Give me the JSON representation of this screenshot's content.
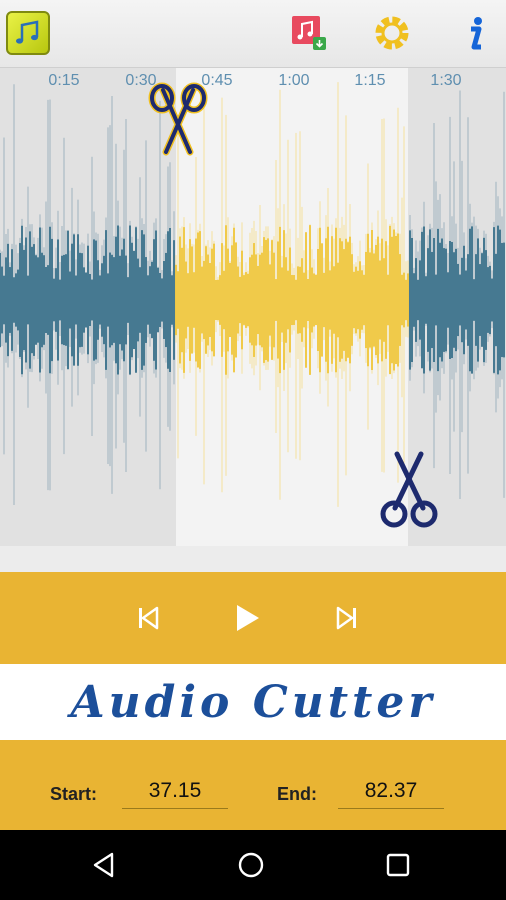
{
  "toolbar": {
    "app_icon": "music-notes-icon",
    "buttons": [
      "music-download-icon",
      "gear-icon",
      "info-icon"
    ]
  },
  "timeline": {
    "labels": [
      "0:15",
      "0:30",
      "0:45",
      "1:00",
      "1:15",
      "1:30"
    ]
  },
  "selection": {
    "start_handle_icon": "scissors-icon",
    "end_handle_icon": "scissors-icon"
  },
  "player": {
    "controls": [
      "skip-previous-icon",
      "play-icon",
      "skip-next-icon"
    ]
  },
  "title": "Audio Cutter",
  "range": {
    "start_label": "Start:",
    "start_value": "37.15",
    "end_label": "End:",
    "end_value": "82.37"
  },
  "colors": {
    "accent": "#e9b433",
    "waveform_unselected": "#1f5f7d",
    "waveform_selected": "#f0c020",
    "title": "#1c4f9a"
  }
}
